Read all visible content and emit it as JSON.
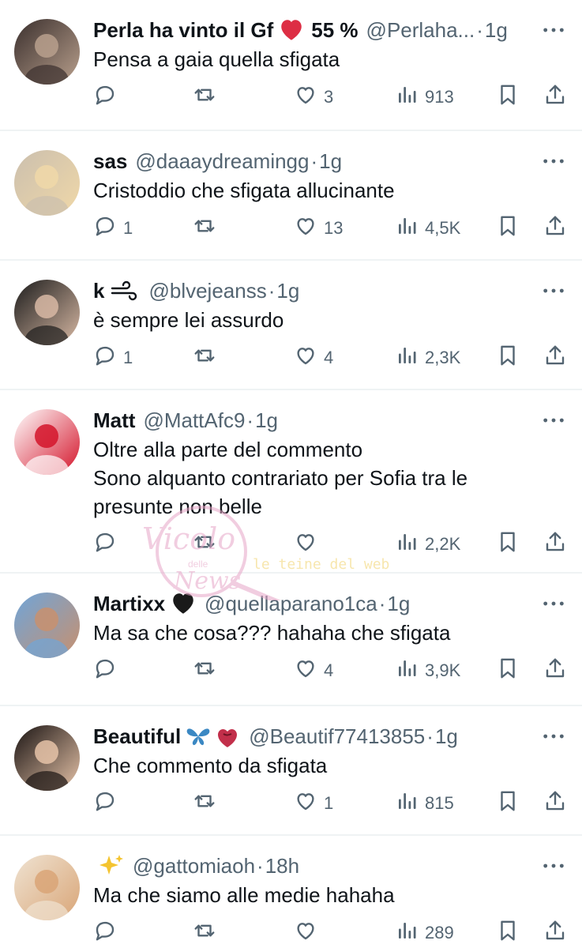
{
  "tweets": [
    {
      "name": "Perla ha vinto il Gf",
      "name_extra": "55 %",
      "emoji": "heart-red",
      "handle": "@Perlaha...",
      "time": "1g",
      "text": "Pensa a gaia quella sfigata",
      "replies": "",
      "likes": "3",
      "views": "913",
      "avatar_colors": [
        "#3a2f2d",
        "#b9a08d"
      ]
    },
    {
      "name": "sas",
      "name_extra": "",
      "emoji": "",
      "handle": "@daaaydreamingg",
      "time": "1g",
      "text": "Cristoddio che sfigata allucinante",
      "replies": "1",
      "likes": "13",
      "views": "4,5K",
      "avatar_colors": [
        "#cbbfae",
        "#f0d8a8"
      ]
    },
    {
      "name": "k",
      "name_extra": "",
      "emoji": "wind",
      "handle": "@blvejeanss",
      "time": "1g",
      "text": "è sempre lei assurdo",
      "replies": "1",
      "likes": "4",
      "views": "2,3K",
      "avatar_colors": [
        "#1c1c1c",
        "#d8b9a4"
      ]
    },
    {
      "name": "Matt",
      "name_extra": "",
      "emoji": "",
      "handle": "@MattAfc9",
      "time": "1g",
      "text": "Oltre alla parte del commento\nSono alquanto contrariato per Sofia tra le presunte non belle",
      "replies": "",
      "likes": "",
      "views": "2,2K",
      "avatar_colors": [
        "#ffffff",
        "#d4142a"
      ]
    },
    {
      "name": "Martixx",
      "name_extra": "",
      "emoji": "heart-black",
      "handle": "@quellaparano1ca",
      "time": "1g",
      "text": "Ma sa che cosa??? hahaha che sfigata",
      "replies": "",
      "likes": "4",
      "views": "3,9K",
      "avatar_colors": [
        "#6fa5d9",
        "#c8906e"
      ]
    },
    {
      "name": "Beautiful",
      "name_extra": "",
      "emoji": "butterfly-heart",
      "handle": "@Beautif77413855",
      "time": "1g",
      "text": "Che commento da sfigata",
      "replies": "",
      "likes": "1",
      "views": "815",
      "avatar_colors": [
        "#1a1413",
        "#e6c3a8"
      ]
    },
    {
      "name": "",
      "name_extra": "",
      "emoji": "sparkles",
      "handle": "@gattomiaoh",
      "time": "18h",
      "text": "Ma che siamo alle medie hahaha",
      "replies": "",
      "likes": "",
      "views": "289",
      "avatar_colors": [
        "#efe3d2",
        "#d9a577"
      ]
    }
  ],
  "watermark": {
    "script": "Vicolo",
    "small": "delle",
    "script2": "News",
    "tagline": "le teine del web"
  },
  "colors": {
    "text": "#0f1419",
    "muted": "#536471",
    "divider": "#eff3f4",
    "watermark_pink": "#e7a6c7"
  }
}
